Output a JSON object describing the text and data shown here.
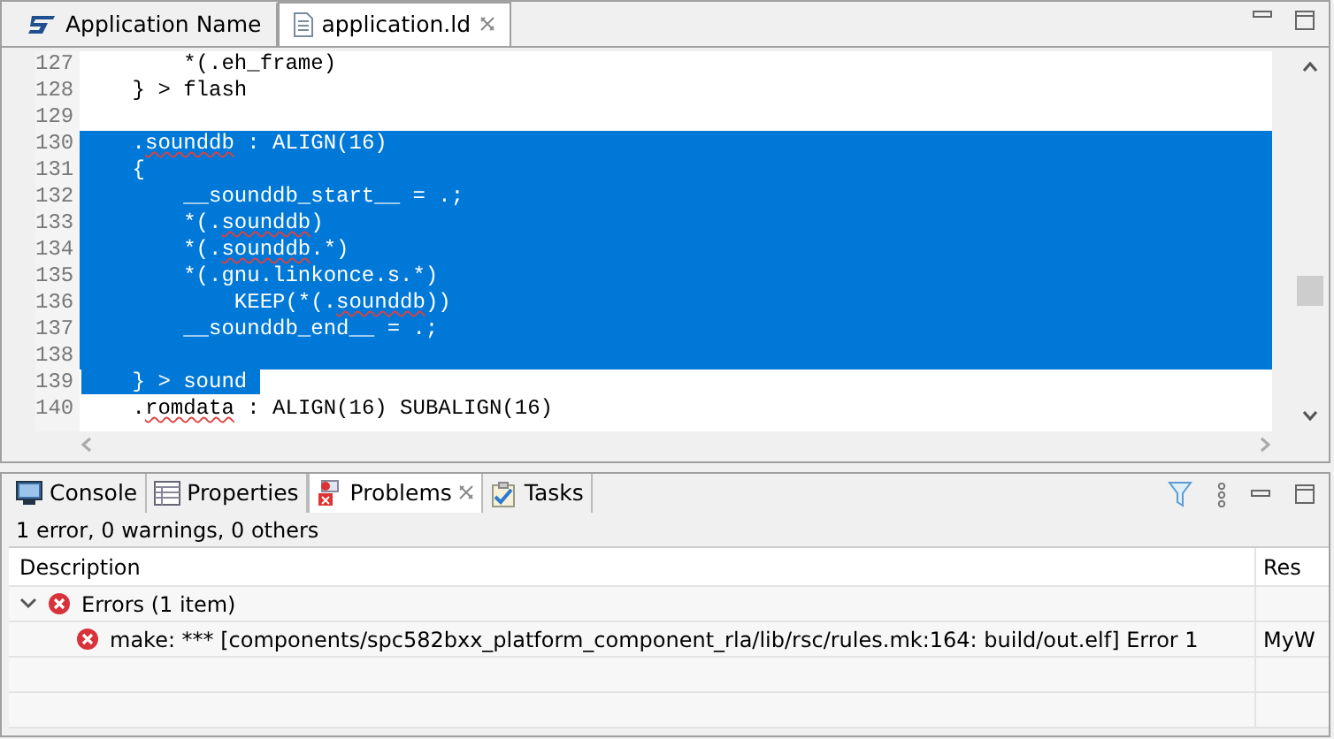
{
  "editor": {
    "tabs": [
      {
        "label": "Application Name",
        "kind": "app",
        "selected": false,
        "closable": false
      },
      {
        "label": "application.ld",
        "kind": "file",
        "selected": true,
        "closable": true
      }
    ],
    "lines": [
      {
        "number": "127",
        "selected": false,
        "segments": [
          {
            "text": "        *(.eh_frame)",
            "misspelled": false
          }
        ]
      },
      {
        "number": "128",
        "selected": false,
        "segments": [
          {
            "text": "    } > flash",
            "misspelled": false
          }
        ]
      },
      {
        "number": "129",
        "selected": false
      },
      {
        "number": "130",
        "selected": true,
        "segments": [
          {
            "text": "    .",
            "misspelled": false
          },
          {
            "text": "sounddb",
            "misspelled": true
          },
          {
            "text": " : ALIGN(16)",
            "misspelled": false
          }
        ]
      },
      {
        "number": "131",
        "selected": true,
        "segments": [
          {
            "text": "    {",
            "misspelled": false
          }
        ]
      },
      {
        "number": "132",
        "selected": true,
        "segments": [
          {
            "text": "        __sounddb_start__ = .;",
            "misspelled": false
          }
        ]
      },
      {
        "number": "133",
        "selected": true,
        "segments": [
          {
            "text": "        *(.",
            "misspelled": false
          },
          {
            "text": "sounddb",
            "misspelled": true
          },
          {
            "text": ")",
            "misspelled": false
          }
        ]
      },
      {
        "number": "134",
        "selected": true,
        "segments": [
          {
            "text": "        *(.",
            "misspelled": false
          },
          {
            "text": "sounddb",
            "misspelled": true
          },
          {
            "text": ".*)",
            "misspelled": false
          }
        ]
      },
      {
        "number": "135",
        "selected": true,
        "segments": [
          {
            "text": "        *(.gnu.linkonce.s.*)",
            "misspelled": false
          }
        ]
      },
      {
        "number": "136",
        "selected": true,
        "segments": [
          {
            "text": "            KEEP(*(.",
            "misspelled": false
          },
          {
            "text": "sounddb",
            "misspelled": true
          },
          {
            "text": "))",
            "misspelled": false
          }
        ]
      },
      {
        "number": "137",
        "selected": true,
        "segments": [
          {
            "text": "        __sounddb_end__ = .;",
            "misspelled": false
          }
        ]
      },
      {
        "number": "138",
        "selected": true
      },
      {
        "number": "139",
        "selected": true,
        "segments": [
          {
            "text": "    } > sound ",
            "misspelled": false
          }
        ]
      },
      {
        "number": "140",
        "selected": false,
        "segments": [
          {
            "text": "    .",
            "misspelled": false
          },
          {
            "text": "romdata",
            "misspelled": true
          },
          {
            "text": " : ALIGN(16) SUBALIGN(16)",
            "misspelled": false
          }
        ]
      }
    ]
  },
  "panel": {
    "tabs": [
      {
        "label": "Console",
        "kind": "console",
        "selected": false,
        "closable": false
      },
      {
        "label": "Properties",
        "kind": "properties",
        "selected": false,
        "closable": false
      },
      {
        "label": "Problems",
        "kind": "problems",
        "selected": true,
        "closable": true
      },
      {
        "label": "Tasks",
        "kind": "tasks",
        "selected": false,
        "closable": false
      }
    ],
    "summary": "1 error, 0 warnings, 0 others",
    "columns": [
      "Description",
      "Res"
    ],
    "rows": [
      {
        "kind": "group",
        "expanded": true,
        "description": "Errors (1 item)"
      },
      {
        "kind": "error",
        "description": "make: *** [components/spc582bxx_platform_component_rla/lib/rsc/rules.mk:164: build/out.elf] Error 1",
        "column_2": "MyW"
      }
    ]
  }
}
